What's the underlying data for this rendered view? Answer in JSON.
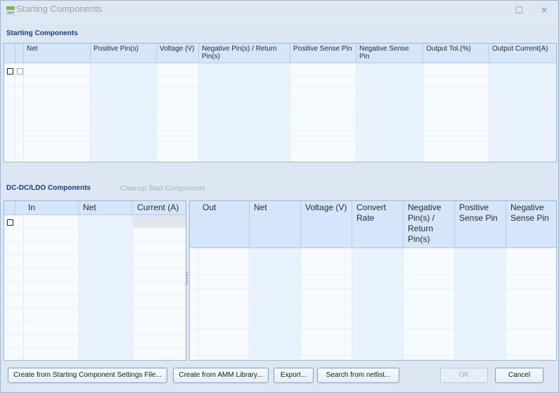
{
  "window": {
    "title": "Starting Components",
    "minimize_icon": "minimize-icon",
    "close_icon": "close-icon"
  },
  "starting": {
    "label": "Starting Components",
    "columns": [
      "Net",
      "Positive Pin(s)",
      "Voltage (V)",
      "Negative Pin(s) / Return Pin(s)",
      "Positive Sense Pin",
      "Negative Sense Pin",
      "Output Tol.(%)",
      "Output Current(A)"
    ]
  },
  "dcdc": {
    "label": "DC-DC/LDO Components",
    "cleanup_link": "Cleanup Start Components",
    "left_columns": [
      "In",
      "Net",
      "Current (A)"
    ],
    "right_columns": [
      "Out",
      "Net",
      "Voltage (V)",
      "Convert Rate",
      "Negative Pin(s) / Return Pin(s)",
      "Positive Sense Pin",
      "Negative Sense Pin"
    ]
  },
  "buttons": {
    "create_from_file": "Create from Starting Component Settings File...",
    "create_from_amm": "Create from AMM Library...",
    "export": "Export...",
    "search_netlist": "Search from netlist...",
    "ok": "OK",
    "cancel": "Cancel"
  }
}
